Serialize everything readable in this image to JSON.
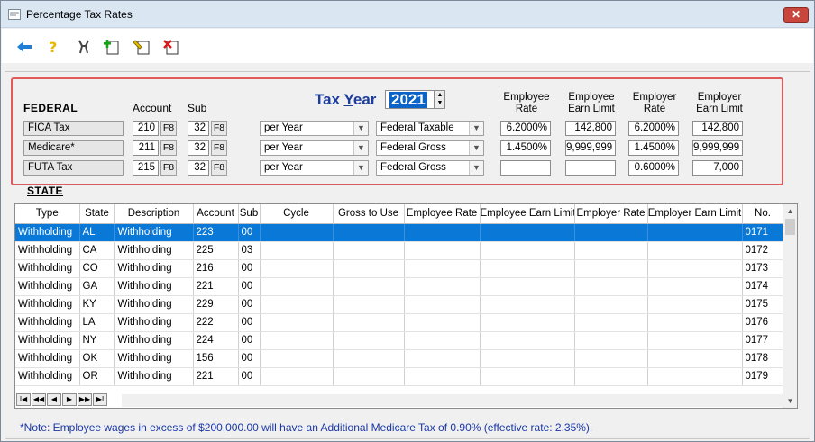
{
  "window": {
    "title": "Percentage Tax Rates",
    "close_label": "✕"
  },
  "toolbar": {
    "buttons": [
      "back-arrow-icon",
      "help-icon",
      "tools-icon",
      "add-record-icon",
      "edit-record-icon",
      "delete-record-icon"
    ]
  },
  "federal": {
    "section_label": "FEDERAL",
    "account_label": "Account",
    "sub_label": "Sub",
    "tax_year_label": "Tax Year",
    "tax_year_underline": "Y",
    "tax_year_value": "2021",
    "col_employee_rate": "Employee Rate",
    "col_employee_earn_limit": "Employee Earn Limit",
    "col_employer_rate": "Employer Rate",
    "col_employer_earn_limit": "Employer Earn Limit",
    "f8": "F8",
    "rows": [
      {
        "name": "FICA Tax",
        "account": "210",
        "sub": "32",
        "cycle": "per Year",
        "gross": "Federal Taxable",
        "ee_rate": "6.2000%",
        "ee_limit": "142,800",
        "er_rate": "6.2000%",
        "er_limit": "142,800"
      },
      {
        "name": "Medicare*",
        "account": "211",
        "sub": "32",
        "cycle": "per Year",
        "gross": "Federal Gross",
        "ee_rate": "1.4500%",
        "ee_limit": "9,999,999",
        "er_rate": "1.4500%",
        "er_limit": "9,999,999"
      },
      {
        "name": "FUTA Tax",
        "account": "215",
        "sub": "32",
        "cycle": "per Year",
        "gross": "Federal Gross",
        "ee_rate": "",
        "ee_limit": "",
        "er_rate": "0.6000%",
        "er_limit": "7,000"
      }
    ]
  },
  "state": {
    "section_label": "STATE",
    "columns": [
      "Type",
      "State",
      "Description",
      "Account",
      "Sub",
      "Cycle",
      "Gross to Use",
      "Employee Rate",
      "Employee Earn Limit",
      "Employer Rate",
      "Employer Earn Limit",
      "No."
    ],
    "rows": [
      [
        "Withholding",
        "AL",
        "Withholding",
        "223",
        "00",
        "",
        "",
        "",
        "",
        "",
        "",
        "0171"
      ],
      [
        "Withholding",
        "CA",
        "Withholding",
        "225",
        "03",
        "",
        "",
        "",
        "",
        "",
        "",
        "0172"
      ],
      [
        "Withholding",
        "CO",
        "Withholding",
        "216",
        "00",
        "",
        "",
        "",
        "",
        "",
        "",
        "0173"
      ],
      [
        "Withholding",
        "GA",
        "Withholding",
        "221",
        "00",
        "",
        "",
        "",
        "",
        "",
        "",
        "0174"
      ],
      [
        "Withholding",
        "KY",
        "Withholding",
        "229",
        "00",
        "",
        "",
        "",
        "",
        "",
        "",
        "0175"
      ],
      [
        "Withholding",
        "LA",
        "Withholding",
        "222",
        "00",
        "",
        "",
        "",
        "",
        "",
        "",
        "0176"
      ],
      [
        "Withholding",
        "NY",
        "Withholding",
        "224",
        "00",
        "",
        "",
        "",
        "",
        "",
        "",
        "0177"
      ],
      [
        "Withholding",
        "OK",
        "Withholding",
        "156",
        "00",
        "",
        "",
        "",
        "",
        "",
        "",
        "0178"
      ],
      [
        "Withholding",
        "OR",
        "Withholding",
        "221",
        "00",
        "",
        "",
        "",
        "",
        "",
        "",
        "0179"
      ]
    ],
    "selected_row": 0,
    "nav_buttons": [
      "I◀",
      "◀◀",
      "◀",
      "▶",
      "▶▶",
      "▶I"
    ]
  },
  "note": "*Note: Employee wages in excess of $200,000.00 will have an Additional Medicare Tax of 0.90% (effective rate: 2.35%).",
  "colors": {
    "accent": "#0a78d7",
    "highlight_border": "#e05a5a",
    "note_text": "#1a37a8",
    "tax_year_text": "#1d3d9e"
  }
}
